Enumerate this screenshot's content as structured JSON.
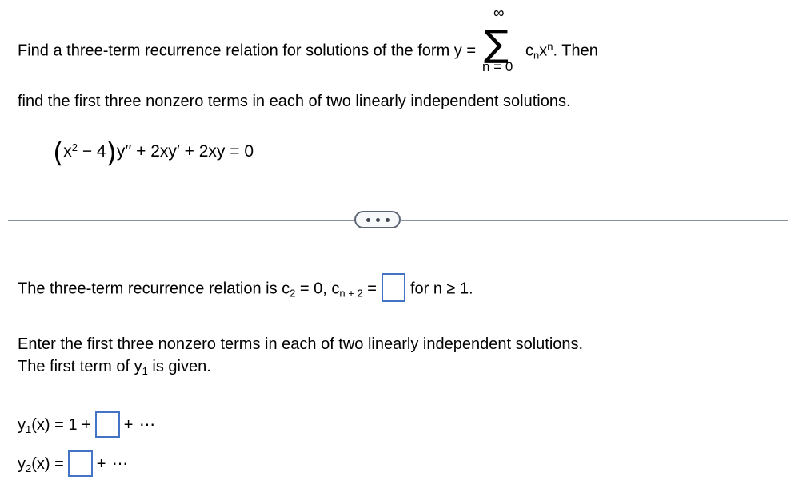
{
  "document": {
    "background_color": "#ffffff",
    "text_color": "#000000"
  },
  "problem": {
    "line1_part1": "Find a three-term recurrence relation for solutions of the form y =",
    "summation": {
      "upper_limit": "∞",
      "symbol": "∑",
      "lower_limit": "n = 0",
      "term_base": "c",
      "term_sub": "n",
      "term_var": "x",
      "term_sup": "n"
    },
    "line1_part2": ". Then",
    "line2": "find the first three nonzero terms in each of two linearly independent solutions.",
    "equation": {
      "open_paren": "(",
      "x": "x",
      "x_exp": "2",
      "minus_four": " − 4",
      "close_paren": ")",
      "rest": "y′′ + 2xy′ + 2xy = 0"
    }
  },
  "divider": {
    "line_color": "#8b93a1",
    "pill_border_color": "#5d6674",
    "pill_fill_color": "#f7f8fa",
    "dot_color": "#3f4650",
    "ellipsis_label": "•••"
  },
  "answer": {
    "recurrence": {
      "prefix": "The three-term recurrence relation is c",
      "c_sub": "2",
      "mid": " = 0, c",
      "cn_sub": "n + 2",
      "equals": " =",
      "suffix": "for n ≥ 1.",
      "input_value": "",
      "input_color": "#4472c4"
    },
    "instructions_line1": "Enter the first three nonzero terms in each of two linearly independent solutions.",
    "instructions_line2_part1": "The first term of y",
    "instructions_line2_sub": "1",
    "instructions_line2_part2": " is given.",
    "y1": {
      "label": "y",
      "label_sub": "1",
      "lhs": "(x) = 1 +",
      "input_value": "",
      "trailing": "+ ⋯"
    },
    "y2": {
      "label": "y",
      "label_sub": "2",
      "lhs": "(x) =",
      "input_value": "",
      "trailing": "+ ⋯"
    }
  }
}
